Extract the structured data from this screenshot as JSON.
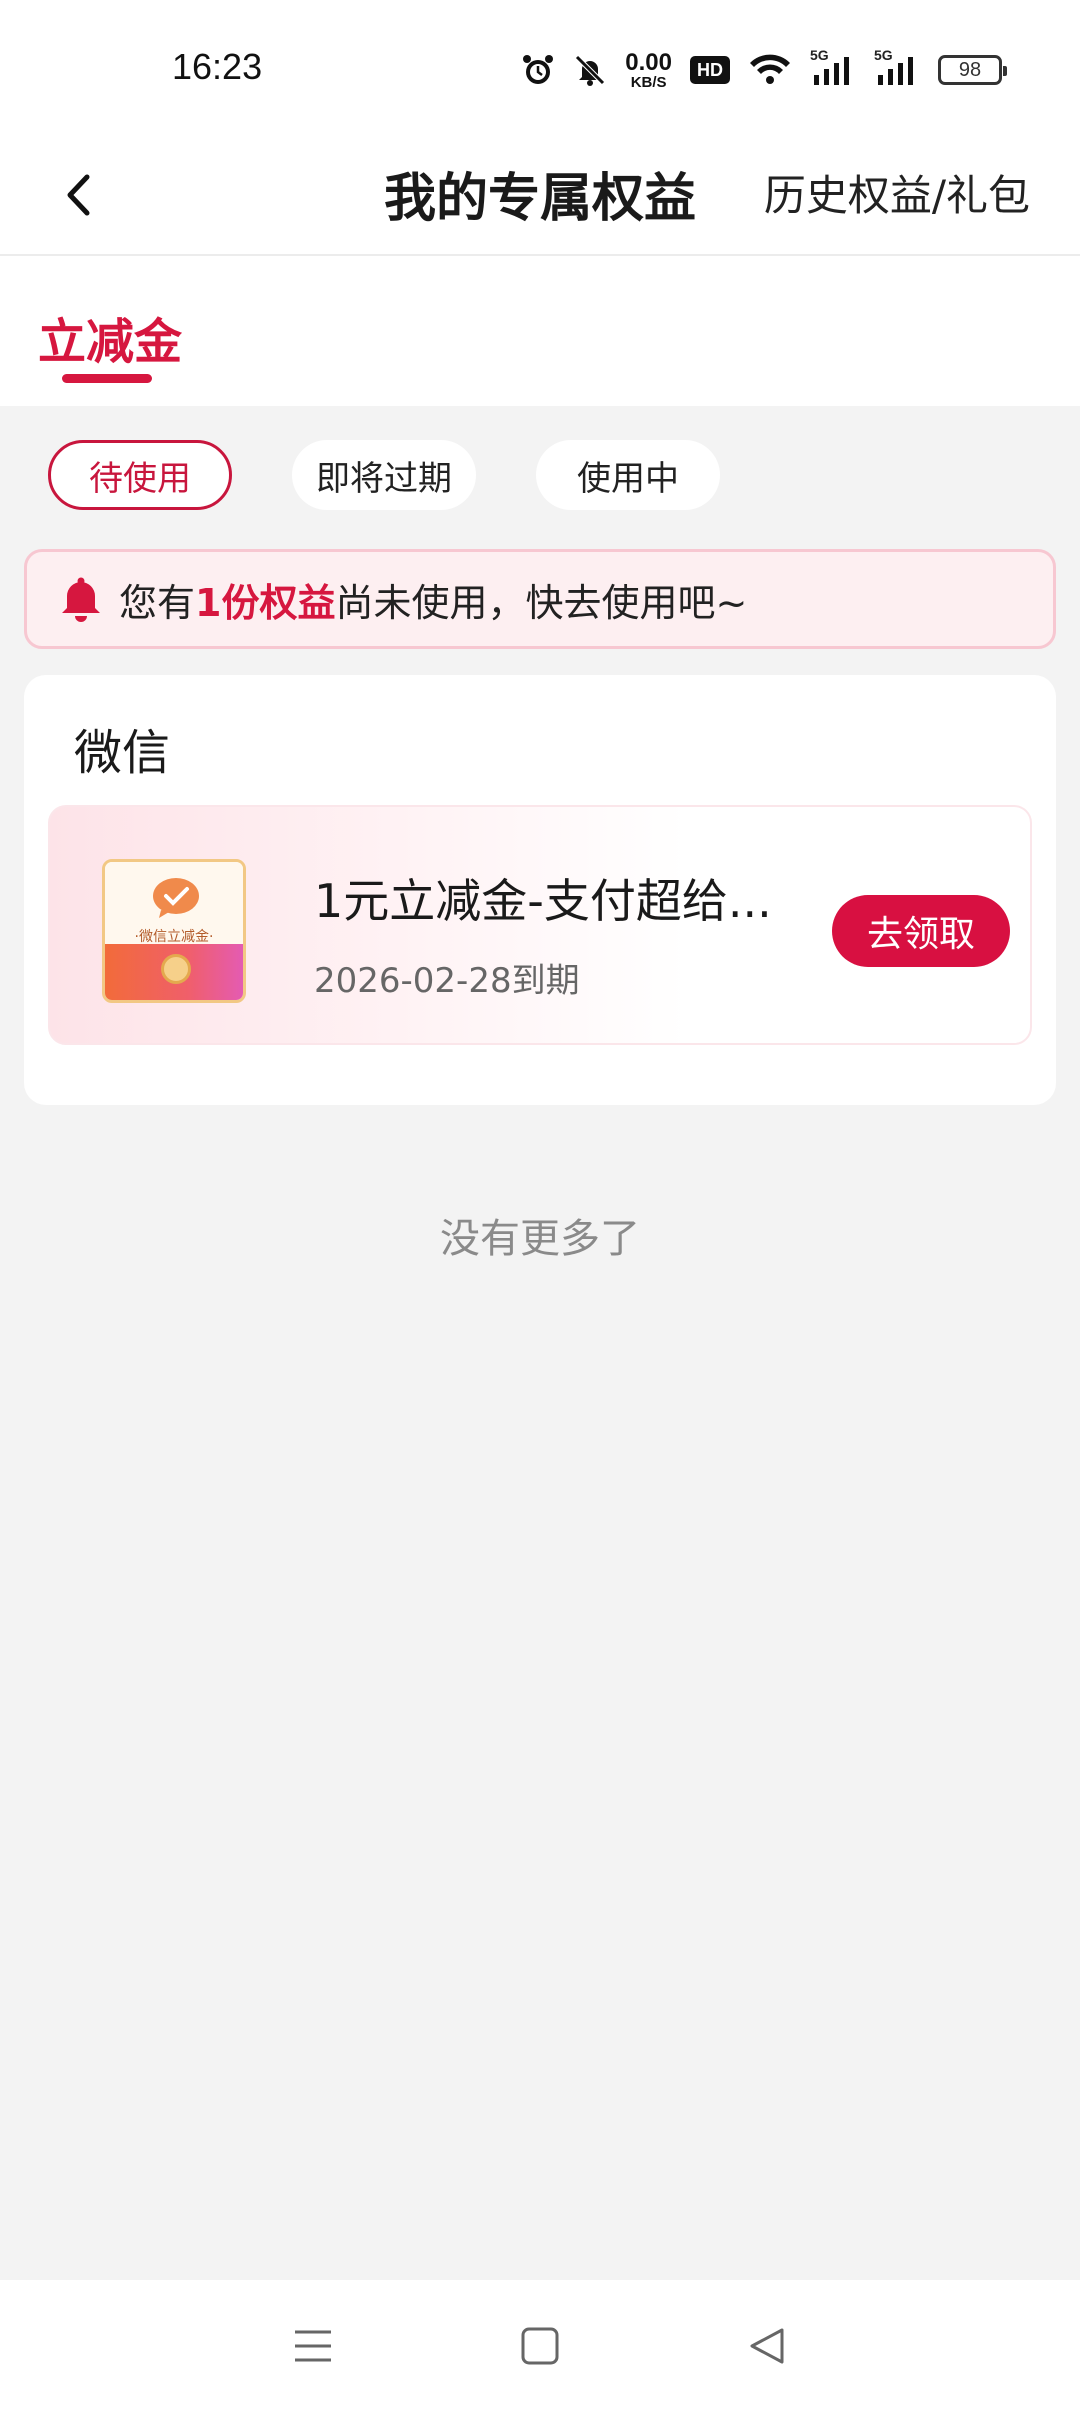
{
  "status_bar": {
    "time": "16:23",
    "net_speed_value": "0.00",
    "net_speed_unit": "KB/S",
    "hd_label": "HD",
    "signal1_label": "5G",
    "signal2_label": "5G",
    "battery": "98",
    "icons": [
      "alarm-icon",
      "mute-icon",
      "hd-icon",
      "wifi-icon",
      "signal-icon",
      "signal-icon",
      "battery-icon"
    ]
  },
  "header": {
    "title": "我的专属权益",
    "history_link": "历史权益/礼包"
  },
  "tabs": {
    "active_label": "立减金"
  },
  "filters": [
    {
      "label": "待使用",
      "active": true
    },
    {
      "label": "即将过期",
      "active": false
    },
    {
      "label": "使用中",
      "active": false
    }
  ],
  "notice": {
    "prefix": "您有",
    "highlight": "1份权益",
    "suffix": "尚未使用，快去使用吧~"
  },
  "card": {
    "title": "微信",
    "coupon": {
      "thumb_label": "·微信立减金·",
      "name": "1元立减金-支付超给...",
      "expiry": "2026-02-28到期",
      "button_label": "去领取"
    }
  },
  "list_end_text": "没有更多了",
  "colors": {
    "accent": "#d6173f",
    "button": "#d81041",
    "background": "#f3f3f3",
    "notice_bg": "#fdeff1"
  }
}
